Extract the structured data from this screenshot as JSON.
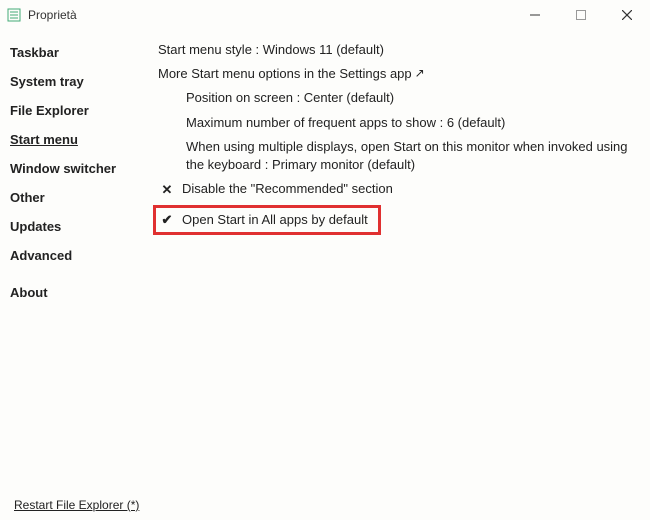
{
  "window": {
    "title": "Proprietà"
  },
  "sidebar": {
    "items": [
      {
        "label": "Taskbar"
      },
      {
        "label": "System tray"
      },
      {
        "label": "File Explorer"
      },
      {
        "label": "Start menu"
      },
      {
        "label": "Window switcher"
      },
      {
        "label": "Other"
      },
      {
        "label": "Updates"
      },
      {
        "label": "Advanced"
      },
      {
        "label": "About"
      }
    ],
    "active_index": 3
  },
  "content": {
    "style_line": "Start menu style : Windows 11 (default)",
    "more_options_line": "More Start menu options in the Settings app",
    "position_line": "Position on screen : Center (default)",
    "max_apps_line": "Maximum number of frequent apps to show : 6 (default)",
    "multi_display_line": "When using multiple displays, open Start on this monitor when invoked using the keyboard : Primary monitor (default)",
    "disable_recommended": "Disable the \"Recommended\" section",
    "open_all_apps": "Open Start in All apps by default",
    "check_icons": {
      "unchecked": "✕",
      "checked": "✔"
    }
  },
  "footer": {
    "restart_label": "Restart File Explorer (*)"
  }
}
